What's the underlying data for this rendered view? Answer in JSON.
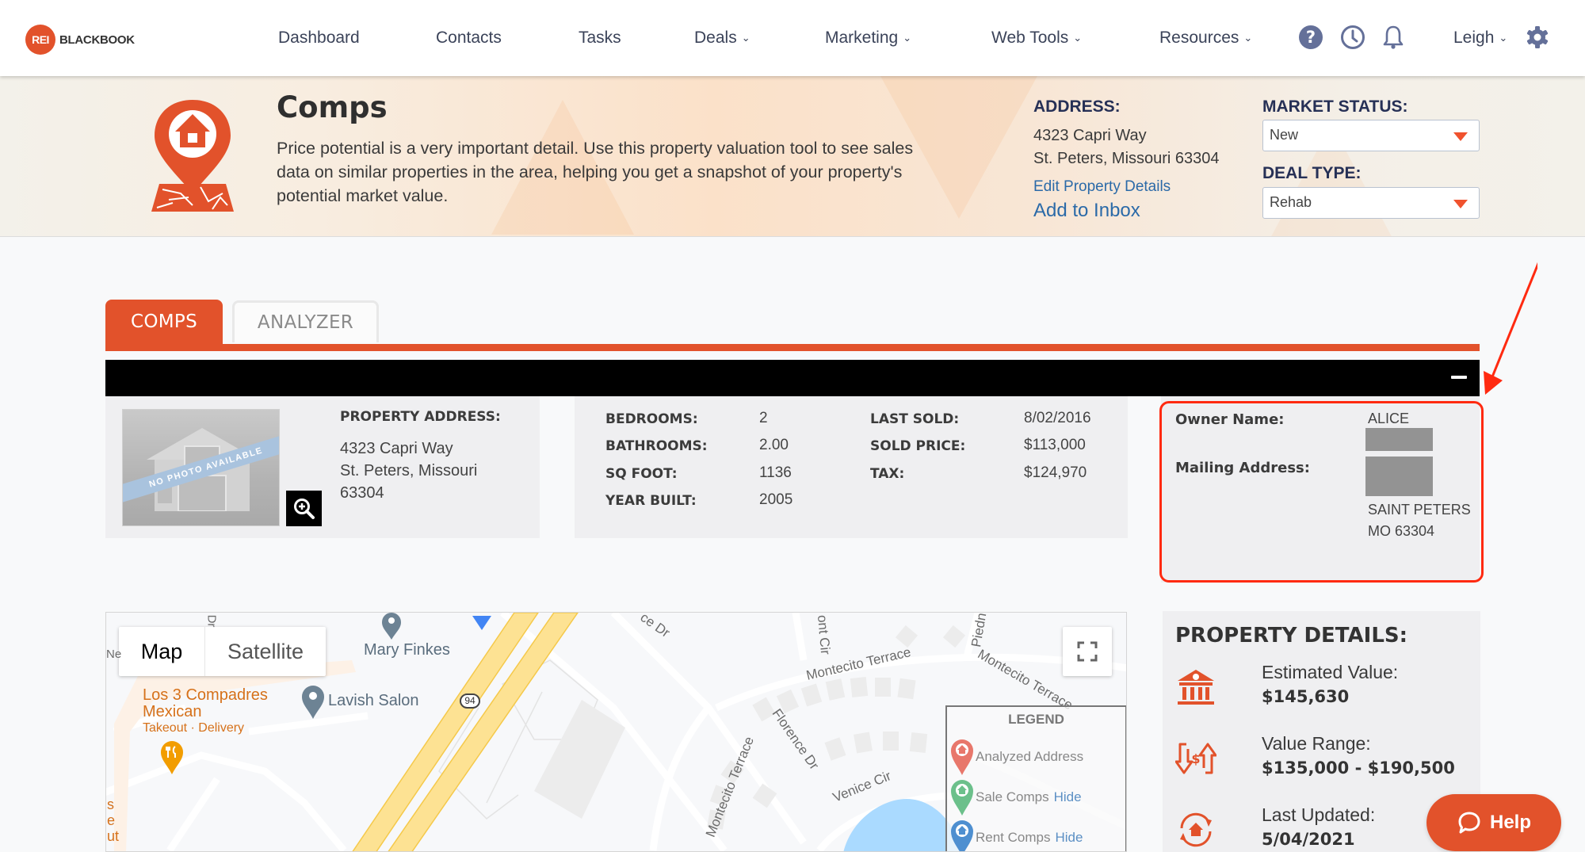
{
  "brand": {
    "logo_badge": "REI",
    "logo_text": "BLACKBOOK",
    "accent": "#e2522b",
    "nav_text_color": "#3b4359",
    "link_color": "#2b6aa8"
  },
  "nav": {
    "items": [
      {
        "label": "Dashboard",
        "dropdown": false
      },
      {
        "label": "Contacts",
        "dropdown": false
      },
      {
        "label": "Tasks",
        "dropdown": false
      },
      {
        "label": "Deals",
        "dropdown": true
      },
      {
        "label": "Marketing",
        "dropdown": true
      },
      {
        "label": "Web Tools",
        "dropdown": true
      },
      {
        "label": "Resources",
        "dropdown": true
      }
    ],
    "icons": [
      "help-icon",
      "history-clock-icon",
      "notification-bell-icon"
    ],
    "user": {
      "label": "Leigh",
      "dropdown": true
    },
    "settings_icon": "gear-icon",
    "chevron": "⌄"
  },
  "hero": {
    "icon": "house-location-pin-map-icon",
    "title": "Comps",
    "description": "Price potential is a very important detail. Use this property valuation tool to see sales data on similar properties in the area, helping you get a snapshot of your property's potential market value.",
    "address_label": "ADDRESS:",
    "address_line1": "4323 Capri Way",
    "address_line2": "St. Peters, Missouri 63304",
    "edit_link": "Edit Property Details",
    "inbox_link": "Add to Inbox",
    "market_status": {
      "label": "MARKET STATUS:",
      "selected": "New"
    },
    "deal_type": {
      "label": "DEAL TYPE:",
      "selected": "Rehab"
    }
  },
  "tabs": [
    {
      "label": "COMPS",
      "active": true
    },
    {
      "label": "ANALYZER",
      "active": false
    }
  ],
  "property": {
    "photo_banner": "NO PHOTO AVAILABLE",
    "address_label": "PROPERTY ADDRESS:",
    "address_lines": [
      "4323 Capri Way",
      "St. Peters, Missouri",
      "63304"
    ],
    "stats_left": [
      {
        "label": "BEDROOMS:",
        "value": "2"
      },
      {
        "label": "BATHROOMS:",
        "value": "2.00"
      },
      {
        "label": "SQ FOOT:",
        "value": "1136"
      },
      {
        "label": "YEAR BUILT:",
        "value": "2005"
      }
    ],
    "stats_right": [
      {
        "label": "LAST SOLD:",
        "value": "8/02/2016"
      },
      {
        "label": "SOLD PRICE:",
        "value": "$113,000"
      },
      {
        "label": "TAX:",
        "value": "$124,970"
      }
    ]
  },
  "owner": {
    "name_label": "Owner Name:",
    "name_value": "ALICE",
    "mailing_label": "Mailing Address:",
    "mailing_city": "SAINT PETERS",
    "mailing_state_zip": "MO 63304",
    "annotation_color": "#ff2a10"
  },
  "map": {
    "type_buttons": [
      "Map",
      "Satellite"
    ],
    "active_type": "Map",
    "labels": {
      "mary_finkes": "Mary Finkes",
      "lavish_salon": "Lavish Salon",
      "restaurant_name_1": "Los 3 Compadres",
      "restaurant_name_2": "Mexican",
      "restaurant_sub": "Takeout · Delivery",
      "route": "94",
      "montecito_terrace": "Montecito Terrace",
      "florence_dr": "Florence Dr",
      "venice_cir": "Venice Cir",
      "venice_dr_partial": "ce Dr",
      "cir_partial": "ont Cir",
      "piedm_partial": "Piedn",
      "dr_partial": "Dr",
      "ne_partial": "Ne",
      "edge_partial": [
        "s",
        "e",
        "ut"
      ]
    },
    "legend": {
      "title": "LEGEND",
      "items": [
        {
          "label": "Analyzed Address",
          "color": "#e8776b",
          "hide": null
        },
        {
          "label": "Sale Comps",
          "color": "#6cc08b",
          "hide": "Hide"
        },
        {
          "label": "Rent Comps",
          "color": "#4e8fd0",
          "hide": "Hide"
        }
      ]
    }
  },
  "property_details": {
    "title": "PROPERTY DETAILS:",
    "rows": [
      {
        "icon": "bank-value-icon",
        "label": "Estimated Value:",
        "value": "$145,630"
      },
      {
        "icon": "value-range-arrows-icon",
        "label": "Value Range:",
        "value": "$135,000 - $190,500"
      },
      {
        "icon": "house-refresh-icon",
        "label": "Last Updated:",
        "value": "5/04/2021"
      }
    ]
  },
  "help": {
    "label": "Help"
  }
}
